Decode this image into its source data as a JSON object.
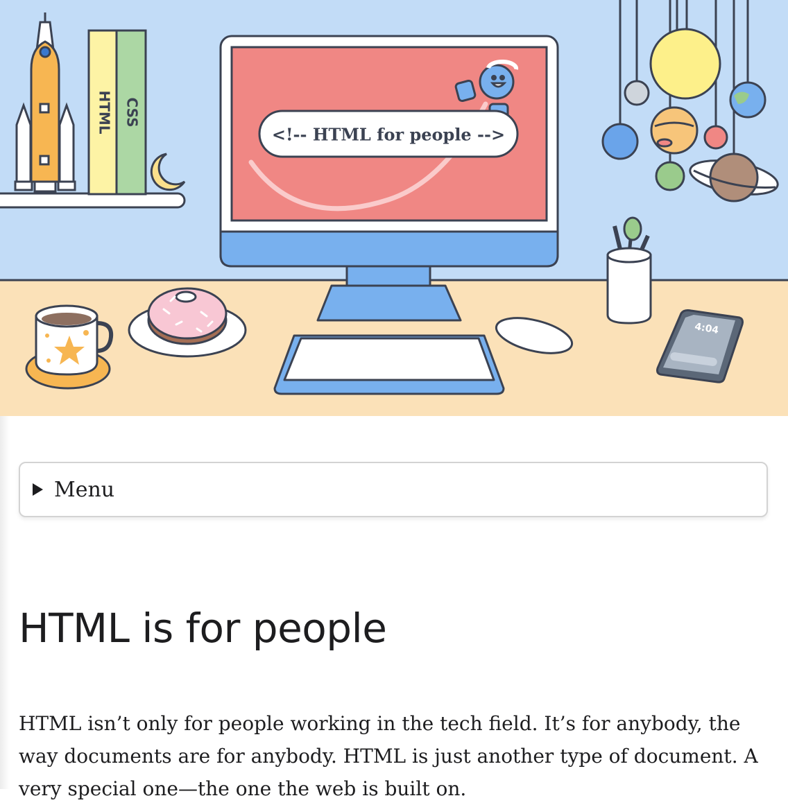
{
  "hero": {
    "screen_text": "<!-- HTML for people -->",
    "book_1": "HTML",
    "book_2": "CSS",
    "phone_time": "4:04",
    "colors": {
      "sky": "#c2dcf7",
      "desk": "#fbe1b8",
      "screen": "#f08784",
      "monitor_base": "#78b0ee",
      "outline": "#3b4252"
    }
  },
  "menu": {
    "label": "Menu"
  },
  "article": {
    "heading": "HTML is for people",
    "intro": "HTML isn’t only for people working in the tech field. It’s for anybody, the way documents are for anybody. HTML is just another type of document. A very special one—the one the web is built on."
  }
}
